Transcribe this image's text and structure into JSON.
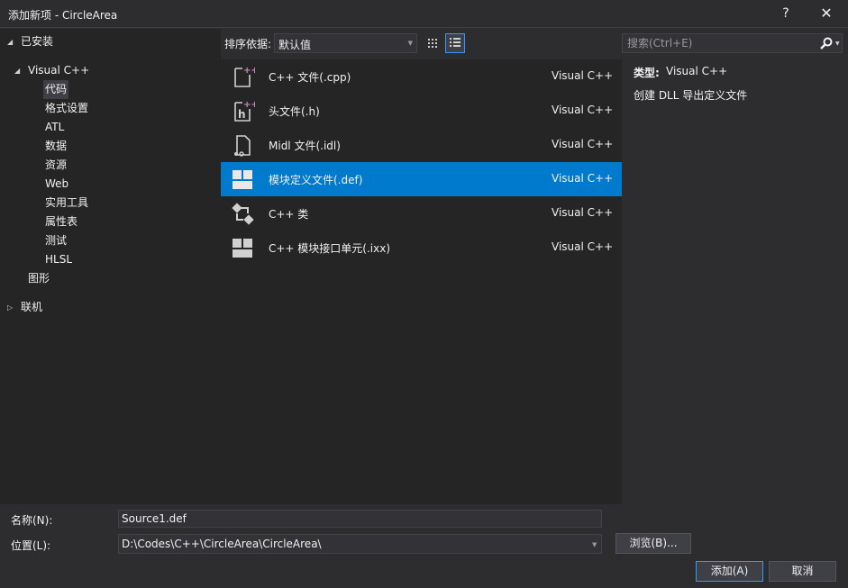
{
  "window": {
    "title": "添加新项 - CircleArea",
    "help_label": "?",
    "close_label": "✕"
  },
  "tree": {
    "installed": "已安装",
    "visual_cpp": "Visual C++",
    "children": [
      "代码",
      "格式设置",
      "ATL",
      "数据",
      "资源",
      "Web",
      "实用工具",
      "属性表",
      "测试",
      "HLSL"
    ],
    "graphics": "图形",
    "online": "联机"
  },
  "toolbar": {
    "sort_label": "排序依据:",
    "sort_value": "默认值"
  },
  "search": {
    "placeholder": "搜索(Ctrl+E)"
  },
  "templates": [
    {
      "name": "C++ 文件(.cpp)",
      "lang": "Visual C++",
      "icon": "cpp-file-icon"
    },
    {
      "name": "头文件(.h)",
      "lang": "Visual C++",
      "icon": "header-file-icon"
    },
    {
      "name": "Midl 文件(.idl)",
      "lang": "Visual C++",
      "icon": "idl-file-icon"
    },
    {
      "name": "模块定义文件(.def)",
      "lang": "Visual C++",
      "icon": "module-def-icon"
    },
    {
      "name": "C++ 类",
      "lang": "Visual C++",
      "icon": "cpp-class-icon"
    },
    {
      "name": "C++ 模块接口单元(.ixx)",
      "lang": "Visual C++",
      "icon": "module-interface-icon"
    }
  ],
  "selected_template_index": 3,
  "details": {
    "type_label": "类型:",
    "type_value": "Visual C++",
    "description": "创建 DLL 导出定义文件"
  },
  "form": {
    "name_label": "名称(N):",
    "name_value": "Source1.def",
    "location_label": "位置(L):",
    "location_value": "D:\\Codes\\C++\\CircleArea\\CircleArea\\",
    "browse_label": "浏览(B)...",
    "add_label": "添加(A)",
    "cancel_label": "取消"
  },
  "colors": {
    "accent": "#007acc",
    "background": "#2d2d30",
    "panel": "#252526"
  }
}
